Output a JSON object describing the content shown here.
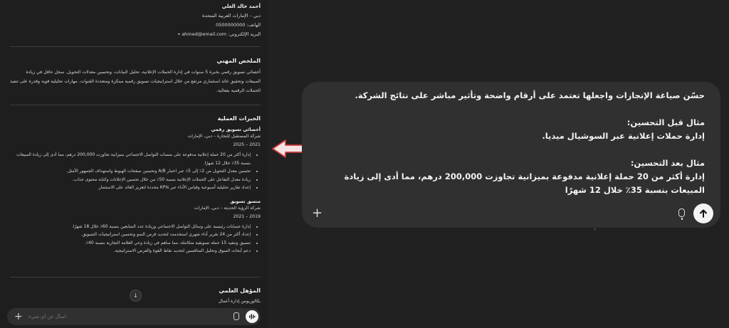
{
  "contact": {
    "name": "أحمد خالد العلي",
    "location": "دبي – الإمارات العربية المتحدة",
    "phone": "الهاتف: 0500000000",
    "email": "البريد الإلكتروني: ahmed@email.com",
    "email_marker": "⌖"
  },
  "summary": {
    "heading": "الملخص المهني",
    "text": "أخصائي تسويق رقمي بخبرة 5 سنوات في إدارة الحملات الإعلانية، تحليل البيانات، وتحسين معدلات التحويل. سجل حافل في زيادة المبيعات وتحقيق عائد استثماري مرتفع من خلال استراتيجيات تسويق رقمية مبتكرة ومتعددة القنوات. مهارات تحليلية قوية وقدرة على تنفيذ الحملات الرقمية بفعالية."
  },
  "experience": {
    "heading": "الخبرات العملية",
    "jobs": [
      {
        "title": "أخصائي تسويق رقمي",
        "company": "شركة المستقبل للتجارة – دبي، الإمارات",
        "dates": "2021 – 2025",
        "bullets": [
          "إدارة أكثر من 20 حملة إعلانية مدفوعة على منصات التواصل الاجتماعي بميزانية تجاوزت 200,000 درهم، مما أدى إلى زيادة المبيعات بنسبة 35٪ خلال 12 شهرًا.",
          "تحسين معدل التحويل من 2٪ إلى 5٪ عبر اختبار A/B وتحسين صفحات الهبوط واستهداف الجمهور الأمثل.",
          "زيادة معدل التفاعل على الحملات الإعلانية بنسبة 50٪ من خلال تحسين الإعلانات وكتابة محتوى جذاب.",
          "إعداد تقارير تحليلية أسبوعية وقياس الأداء عبر KPIs محددة لتعزيز العائد على الاستثمار."
        ]
      },
      {
        "title": "منسق تسويق",
        "company": "شركة الرؤية الحديثة – دبي، الإمارات",
        "dates": "2019 – 2021",
        "bullets": [
          "إدارة حسابات رئيسية على وسائل التواصل الاجتماعي وزيادة عدد المتابعين بنسبة 60٪ خلال 18 شهرًا.",
          "إعداد أكثر من 24 تقرير أداء شهري استخدمت لتحديد فرص النمو وتحسين استراتيجيات التسويق.",
          "تنسيق وتنفيذ 15 حملة تسويقية متكاملة، مما ساهم في زيادة وعي العلامة التجارية بنسبة 40٪.",
          "دعم أبحاث السوق وتحليل المنافسين لتحديد نقاط القوة والفرص الاستراتيجية."
        ]
      }
    ]
  },
  "education": {
    "heading": "المؤهل العلمي",
    "degree": "بكالوريوس إدارة أعمال"
  },
  "mini_input": {
    "plus": "+",
    "placeholder": "اسأل عن أي شيء"
  },
  "bubble": {
    "line1": "حسّن صياغة الإنجازات واجعلها تعتمد على أرقام واضحة وتأثير مباشر على نتائج الشركة.",
    "before_label": "مثال قبل التحسين:",
    "before_text": "إدارة حملات إعلانية عبر السوشيال ميديا.",
    "after_label": "مثال بعد التحسين:",
    "after_text": "إدارة أكثر من 20 حملة إعلانية مدفوعة بميزانية تجاوزت 200,000 درهم، مما أدى إلى زيادة المبيعات بنسبة 35٪ خلال 12 شهرًا",
    "plus": "+"
  },
  "colors": {
    "background": "#212121",
    "panel": "#1e1e1e",
    "bubble": "#303030",
    "send_button": "#f4f4f4",
    "arrow_fill": "#f6e3e3",
    "arrow_outline": "#c93a3a"
  },
  "icons": {
    "scroll": "chevron-down-icon",
    "send": "arrow-up-icon",
    "mic": "microphone-icon",
    "arrow": "left-arrow-annotation"
  }
}
